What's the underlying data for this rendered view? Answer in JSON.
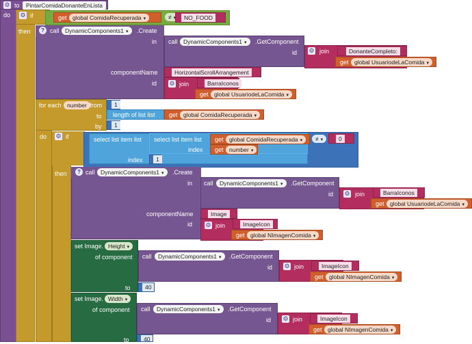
{
  "procedure": {
    "to_label": "to",
    "name": "PintarComidaDonanteEnLista",
    "do_label": "do"
  },
  "kw": {
    "if": "if",
    "then": "then",
    "do": "do",
    "call": "call",
    "in": "in",
    "id": "id",
    "componentName": "componentName",
    "join": "join",
    "get": "get",
    "for_each": "for each",
    "from": "from",
    "to": "to",
    "by": "by",
    "select_list_item": "select list item  list",
    "index": "index",
    "length_of_list": "length of list  list",
    "of_component": "of component",
    "set_image": "set Image."
  },
  "components": {
    "dynamic": "DynamicComponents1",
    "create": ".Create",
    "get_component": ".GetComponent"
  },
  "vars": {
    "comida_recuperada": "global ComidaRecuperada",
    "usuario_la_comida": "global UsuariodeLaComida",
    "nimagen_comida": "global NImagenComida",
    "number": "number"
  },
  "ops": {
    "neq": "≠"
  },
  "texts": {
    "no_food": "NO_FOOD",
    "donante_completo": "DonanteCompleto:",
    "horizontal_scroll": "HorizontalScrollArrangement",
    "barra_iconos": "BarraIconos",
    "zero": "0",
    "image": "Image",
    "image_icon": "ImageIcon"
  },
  "props": {
    "height": "Height",
    "width": "Width"
  },
  "numbers": {
    "one": "1",
    "forty": "40"
  }
}
